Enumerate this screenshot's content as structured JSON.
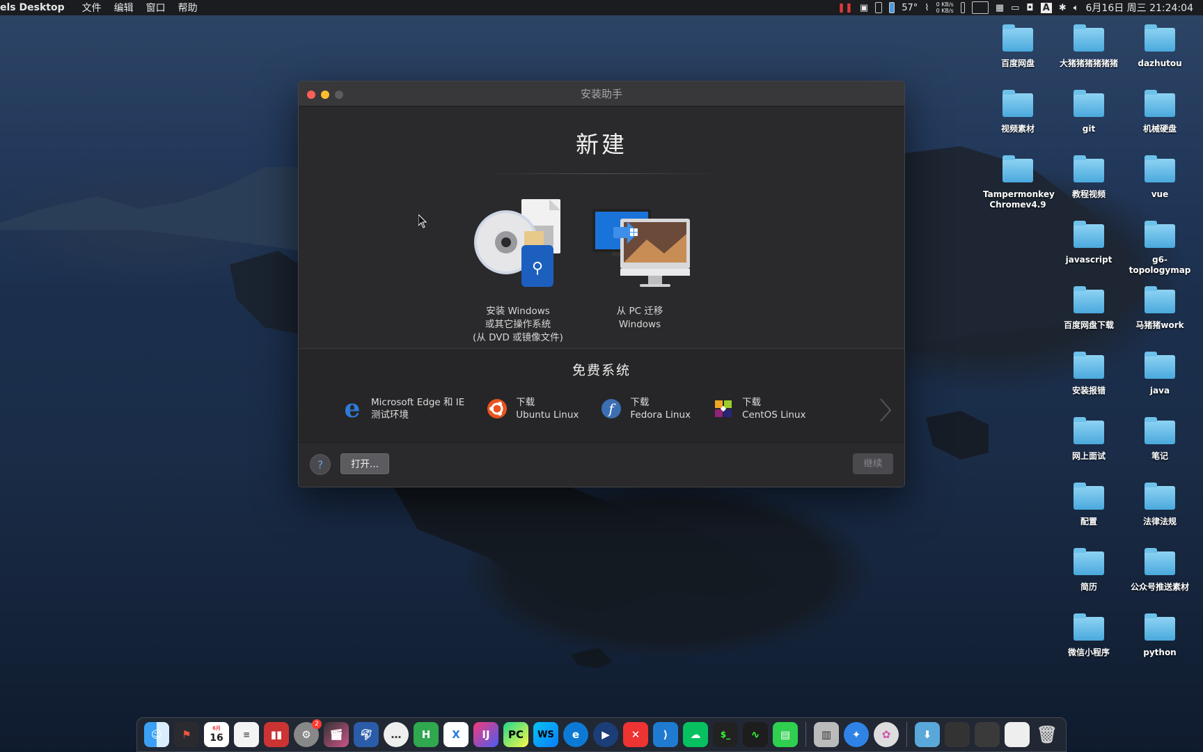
{
  "menubar": {
    "app_name": "els Desktop",
    "menus": [
      "文件",
      "编辑",
      "窗口",
      "帮助"
    ],
    "temperature": "57°",
    "net_up": "0 KB/s",
    "net_down": "0 KB/s",
    "input_method": "A",
    "datetime": "6月16日 周三 21:24:04"
  },
  "desktop": {
    "icons": [
      "百度网盘",
      "大猪猪猪猪猪猪",
      "dazhutou",
      "视频素材",
      "git",
      "机械硬盘",
      "Tampermonkey Chromev4.9",
      "教程视频",
      "vue",
      "javascript",
      "g6-topologymap",
      "百度网盘下载",
      "马猪猪work",
      "安装报错",
      "java",
      "网上面试",
      "笔记",
      "配置",
      "法律法规",
      "简历",
      "公众号推送素材",
      "微信小程序",
      "python"
    ]
  },
  "window": {
    "title": "安装助手",
    "heading": "新建",
    "option_install": {
      "line1": "安装 Windows",
      "line2": "或其它操作系统",
      "line3": "(从 DVD 或镜像文件)"
    },
    "option_migrate": {
      "line1": "从 PC 迁移",
      "line2": "Windows"
    },
    "free_heading": "免费系统",
    "free_items": [
      {
        "line1": "Microsoft Edge 和 IE",
        "line2": "测试环境"
      },
      {
        "line1": "下载",
        "line2": "Ubuntu Linux"
      },
      {
        "line1": "下载",
        "line2": "Fedora Linux"
      },
      {
        "line1": "下载",
        "line2": "CentOS Linux"
      }
    ],
    "help_label": "?",
    "open_label": "打开...",
    "continue_label": "继续"
  },
  "dock": {
    "calendar_month": "6月",
    "calendar_day": "16",
    "badge_count": "2",
    "items": [
      "finder",
      "launchpad",
      "calendar",
      "reminders",
      "parallels",
      "system-preferences",
      "final-cut",
      "sequel",
      "messages",
      "hbuilder",
      "xcode-like",
      "intellij",
      "pycharm",
      "webstorm",
      "edge",
      "quicktime",
      "xmind",
      "vscode",
      "wechat",
      "terminal",
      "activity-monitor",
      "notes",
      "archive",
      "safari",
      "photos",
      "downloads",
      "trash"
    ]
  },
  "colors": {
    "accent_blue": "#4aa9dd",
    "window_bg": "#2a2a2c"
  }
}
